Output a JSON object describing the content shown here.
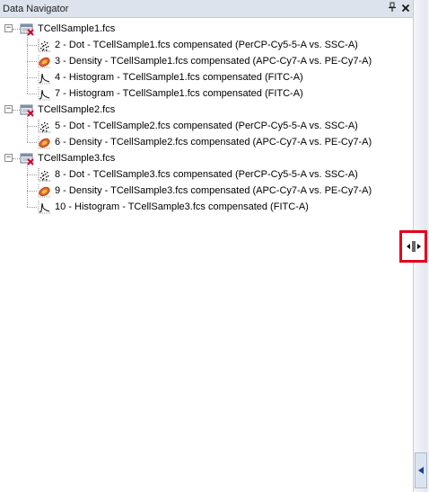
{
  "panel": {
    "title": "Data Navigator",
    "pin_glyph": "⫏",
    "close_glyph": "✕"
  },
  "colors": {
    "header_bg": "#dde3ec",
    "highlight_border": "#e4001b",
    "density_icon": "#d9542b"
  },
  "tree": [
    {
      "label": "TCellSample1.fcs",
      "icon": "fcs-file-icon",
      "children": [
        {
          "label": "2 - Dot - TCellSample1.fcs compensated (PerCP-Cy5-5-A vs. SSC-A)",
          "icon": "dot-plot-icon"
        },
        {
          "label": "3 - Density - TCellSample1.fcs compensated (APC-Cy7-A vs. PE-Cy7-A)",
          "icon": "density-plot-icon"
        },
        {
          "label": "4 - Histogram - TCellSample1.fcs compensated (FITC-A)",
          "icon": "histogram-icon"
        },
        {
          "label": "7 - Histogram - TCellSample1.fcs compensated (FITC-A)",
          "icon": "histogram-icon"
        }
      ]
    },
    {
      "label": "TCellSample2.fcs",
      "icon": "fcs-file-icon",
      "children": [
        {
          "label": "5 - Dot - TCellSample2.fcs compensated (PerCP-Cy5-5-A vs. SSC-A)",
          "icon": "dot-plot-icon"
        },
        {
          "label": "6 - Density - TCellSample2.fcs compensated (APC-Cy7-A vs. PE-Cy7-A)",
          "icon": "density-plot-icon"
        }
      ]
    },
    {
      "label": "TCellSample3.fcs",
      "icon": "fcs-file-icon",
      "children": [
        {
          "label": "8 - Dot - TCellSample3.fcs compensated (PerCP-Cy5-5-A vs. SSC-A)",
          "icon": "dot-plot-icon"
        },
        {
          "label": "9 - Density - TCellSample3.fcs compensated (APC-Cy7-A vs. PE-Cy7-A)",
          "icon": "density-plot-icon"
        },
        {
          "label": "10 - Histogram - TCellSample3.fcs compensated (FITC-A)",
          "icon": "histogram-icon"
        }
      ]
    }
  ],
  "expander_glyph": "−"
}
